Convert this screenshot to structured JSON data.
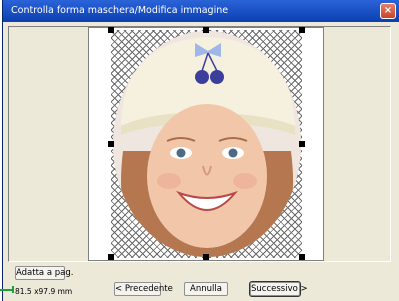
{
  "window": {
    "title": "Controlla forma maschera/Modifica immagine",
    "close_symbol": "×"
  },
  "image": {
    "subject": "photo-portrait",
    "mask_shape": "oval"
  },
  "buttons": {
    "fit_page": "Adatta a pag.",
    "previous": "< Precedente",
    "cancel": "Annulla",
    "next": "Successivo >"
  },
  "size_readout": "81.5 x97.9 mm",
  "colors": {
    "titlebar": "#0b3fb0",
    "dialog_bg": "#ece9d8",
    "hatch": "#6a6a6a",
    "indicator": "#1aa23a"
  },
  "icons": {
    "close": "close-icon"
  }
}
